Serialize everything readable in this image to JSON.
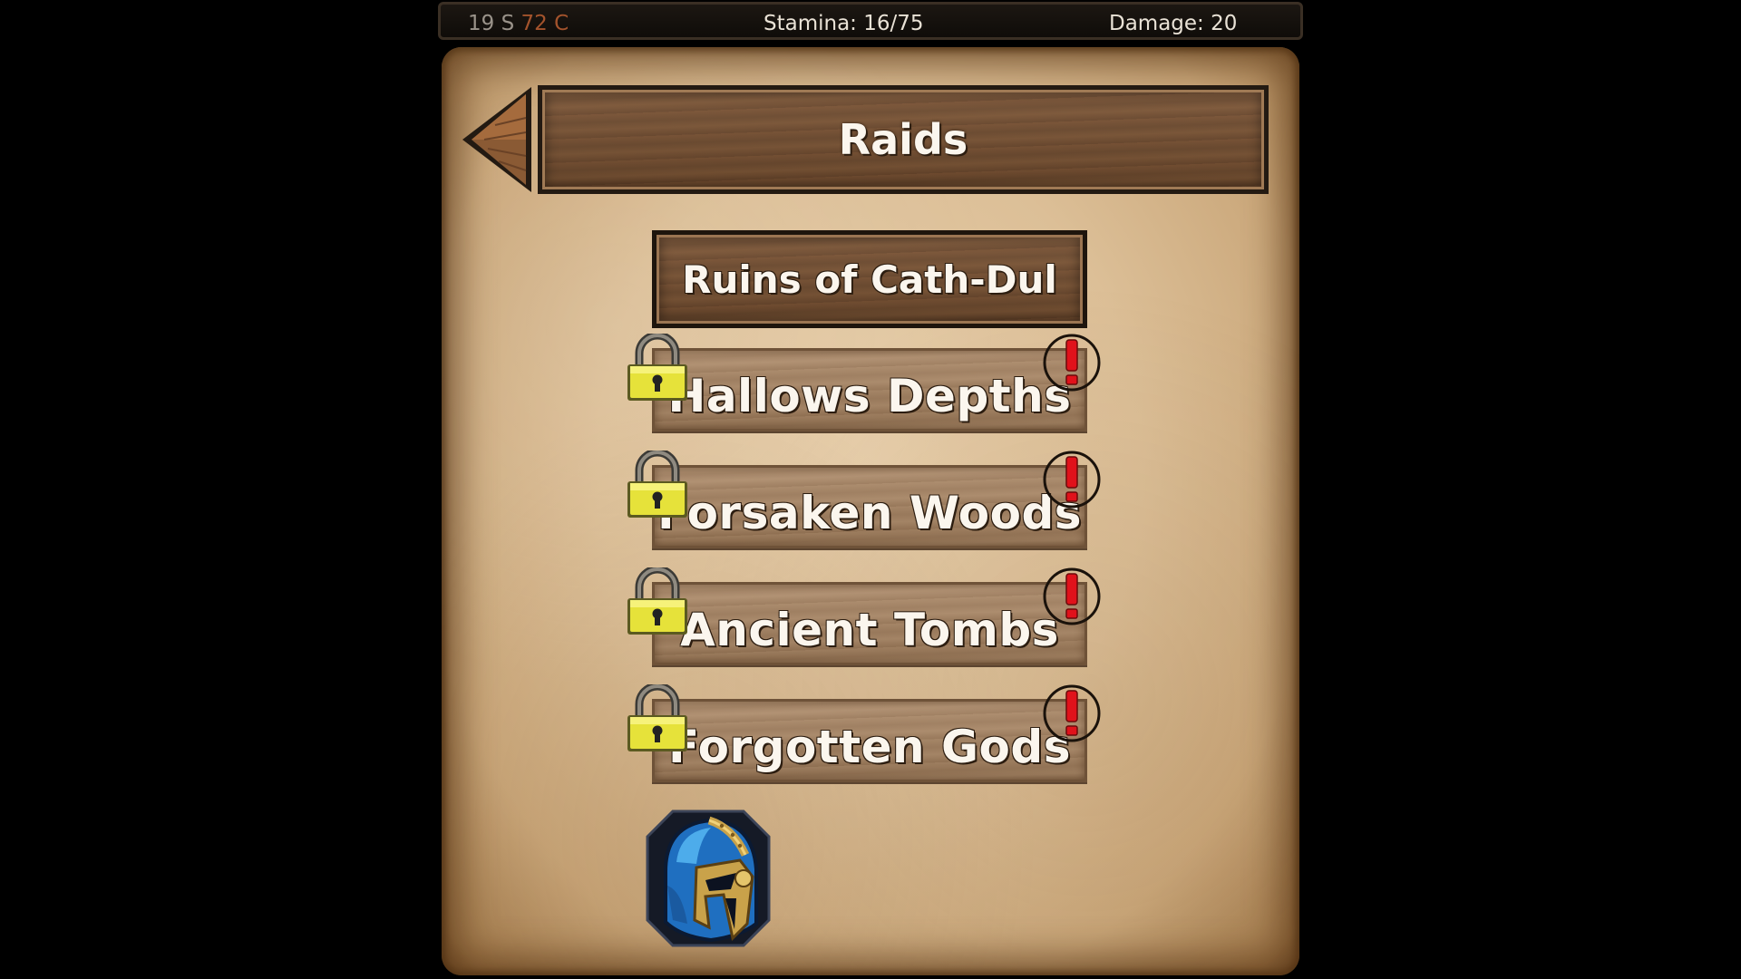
{
  "status": {
    "silver": "19 S",
    "copper": "72 C",
    "stamina": "Stamina: 16/75",
    "damage": "Damage: 20"
  },
  "header": {
    "title": "Raids"
  },
  "raids": [
    {
      "label": "Ruins of Cath-Dul",
      "locked": false,
      "alert": false
    },
    {
      "label": "Hallows Depths",
      "locked": true,
      "alert": true
    },
    {
      "label": "Forsaken Woods",
      "locked": true,
      "alert": true
    },
    {
      "label": "Ancient Tombs",
      "locked": true,
      "alert": true
    },
    {
      "label": "Forgotten Gods",
      "locked": true,
      "alert": true
    }
  ],
  "icons": {
    "back": "back-arrow-icon",
    "lock": "padlock-icon",
    "alert": "exclamation-icon",
    "character": "blue-helmet-icon"
  },
  "colors": {
    "silver": "#9a938a",
    "copper": "#a3532c",
    "alert_red": "#e0121b",
    "lock_gold": "#d9d52a",
    "helmet_blue": "#1f7fd1"
  }
}
